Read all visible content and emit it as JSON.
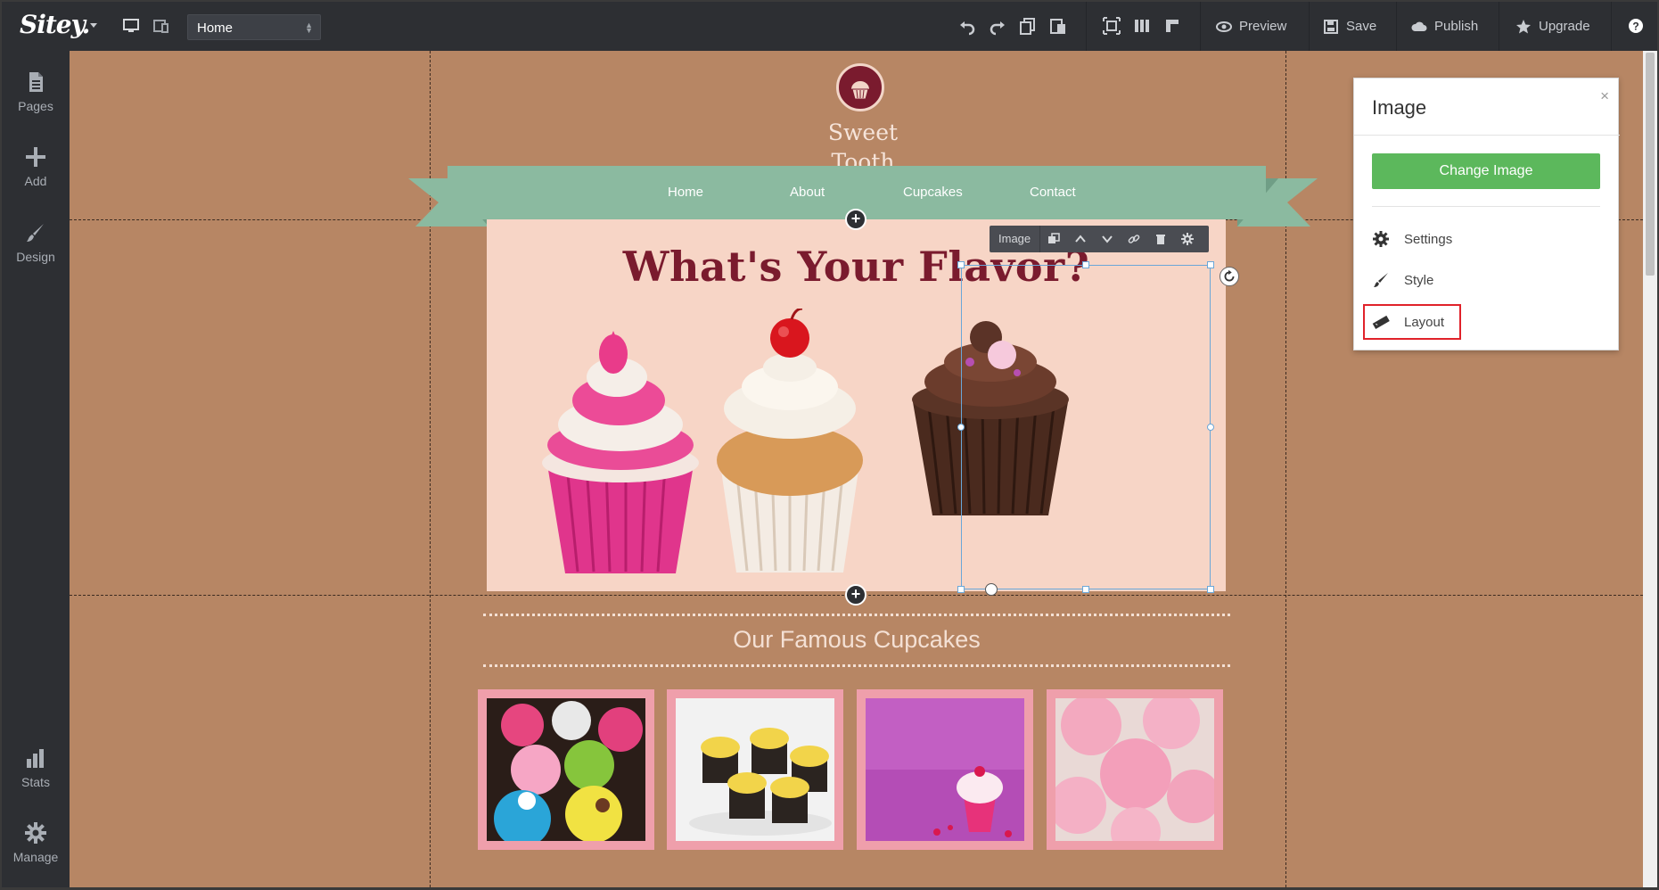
{
  "app": {
    "logo_text": "Sitey.",
    "page_selector": "Home"
  },
  "toolbar": {
    "preview_label": "Preview",
    "save_label": "Save",
    "publish_label": "Publish",
    "upgrade_label": "Upgrade"
  },
  "sidebar": {
    "items": [
      {
        "label": "Pages",
        "icon": "page-icon"
      },
      {
        "label": "Add",
        "icon": "plus-icon"
      },
      {
        "label": "Design",
        "icon": "brush-icon"
      },
      {
        "label": "Stats",
        "icon": "bar-chart-icon"
      },
      {
        "label": "Manage",
        "icon": "gear-icon"
      }
    ]
  },
  "site": {
    "name_line1": "Sweet",
    "name_line2": "Tooth",
    "nav": [
      "Home",
      "About",
      "Cupcakes",
      "Contact"
    ],
    "hero_title": "What's Your Flavor?",
    "section_title": "Our Famous Cupcakes"
  },
  "element_toolbar": {
    "label": "Image"
  },
  "panel": {
    "title": "Image",
    "close": "×",
    "change_image": "Change Image",
    "items": [
      {
        "label": "Settings",
        "icon": "gear-icon"
      },
      {
        "label": "Style",
        "icon": "brush-icon"
      },
      {
        "label": "Layout",
        "icon": "ruler-icon"
      }
    ]
  },
  "colors": {
    "chrome": "#2d2f33",
    "canvas": "#b78664",
    "ribbon": "#8bbaa0",
    "hero_bg": "#f7d5c6",
    "brand": "#7a1b2e",
    "button_green": "#5cb85c",
    "highlight_red": "#e0222a"
  }
}
